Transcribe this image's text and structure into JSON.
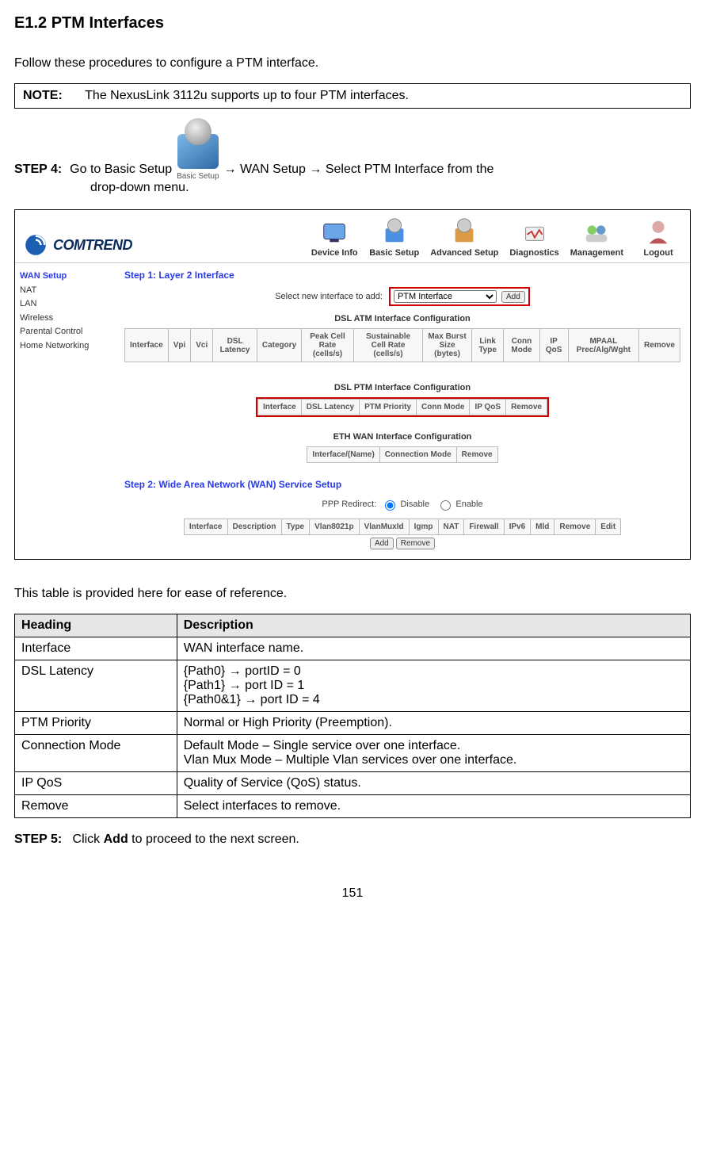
{
  "heading": "E1.2 PTM Interfaces",
  "intro": "Follow these procedures to configure a PTM interface.",
  "note": {
    "label": "NOTE:",
    "text": "The NexusLink 3112u supports up to four PTM interfaces."
  },
  "step4": {
    "label": "STEP 4:",
    "pre": "Go to Basic Setup",
    "icon_caption": "Basic Setup",
    "post": "→ WAN Setup → Select PTM Interface from the",
    "cont": "drop-down menu."
  },
  "shot": {
    "brand": "COMTREND",
    "topnav": [
      {
        "label": "Device Info"
      },
      {
        "label": "Basic Setup"
      },
      {
        "label": "Advanced Setup"
      },
      {
        "label": "Diagnostics"
      },
      {
        "label": "Management"
      },
      {
        "label": "Logout"
      }
    ],
    "sidebar": [
      "WAN Setup",
      "NAT",
      "LAN",
      "Wireless",
      "Parental Control",
      "Home Networking"
    ],
    "step1": "Step 1: Layer 2 Interface",
    "select_label": "Select new interface to add:",
    "select_value": "PTM Interface",
    "add_btn": "Add",
    "atm_title": "DSL ATM Interface Configuration",
    "atm_headers": [
      "Interface",
      "Vpi",
      "Vci",
      "DSL Latency",
      "Category",
      "Peak Cell Rate (cells/s)",
      "Sustainable Cell Rate (cells/s)",
      "Max Burst Size (bytes)",
      "Link Type",
      "Conn Mode",
      "IP QoS",
      "MPAAL Prec/Alg/Wght",
      "Remove"
    ],
    "ptm_title": "DSL PTM Interface Configuration",
    "ptm_headers": [
      "Interface",
      "DSL Latency",
      "PTM Priority",
      "Conn Mode",
      "IP QoS",
      "Remove"
    ],
    "eth_title": "ETH WAN Interface Configuration",
    "eth_headers": [
      "Interface/(Name)",
      "Connection Mode",
      "Remove"
    ],
    "step2": "Step 2: Wide Area Network (WAN) Service Setup",
    "ppp_label": "PPP Redirect:",
    "ppp_disable": "Disable",
    "ppp_enable": "Enable",
    "wan_headers": [
      "Interface",
      "Description",
      "Type",
      "Vlan8021p",
      "VlanMuxId",
      "Igmp",
      "NAT",
      "Firewall",
      "IPv6",
      "Mld",
      "Remove",
      "Edit"
    ],
    "add": "Add",
    "remove": "Remove"
  },
  "after_intro": "This table is provided here for ease of reference.",
  "ref": {
    "head_h": "Heading",
    "head_d": "Description",
    "rows": [
      {
        "h": "Interface",
        "d": "WAN interface name."
      },
      {
        "h": "DSL Latency",
        "d": "{Path0} → portID = 0\n{Path1} → port ID = 1\n{Path0&1} → port ID = 4"
      },
      {
        "h": "PTM Priority",
        "d": "Normal or High Priority (Preemption)."
      },
      {
        "h": "Connection Mode",
        "d": "Default Mode – Single service over one interface.\nVlan Mux Mode – Multiple Vlan services over one interface."
      },
      {
        "h": "IP QoS",
        "d": "Quality of Service (QoS) status."
      },
      {
        "h": "Remove",
        "d": "Select interfaces to remove."
      }
    ]
  },
  "step5": {
    "label": "STEP 5:",
    "pre": "Click ",
    "bold": "Add",
    "post": " to proceed to the next screen."
  },
  "pagenum": "151"
}
